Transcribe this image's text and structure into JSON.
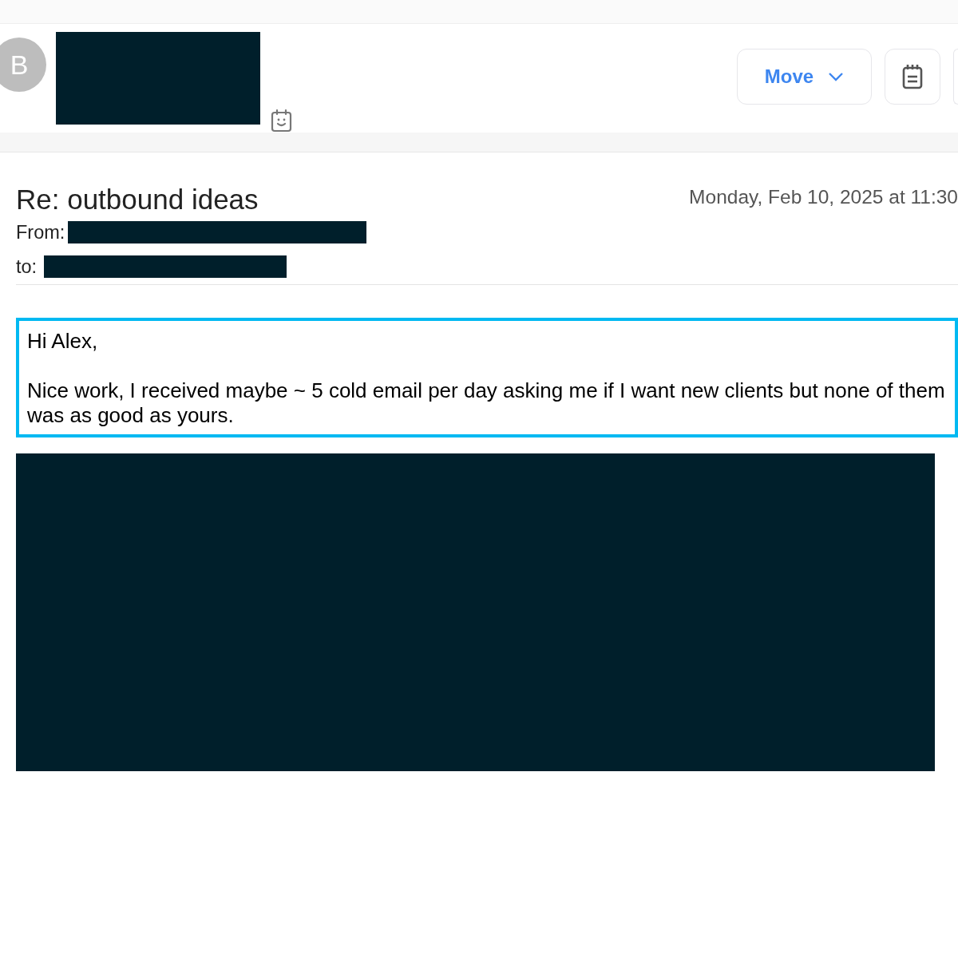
{
  "sender": {
    "avatar_letter": "B"
  },
  "toolbar": {
    "move_button": "Move"
  },
  "message": {
    "subject": "Re: outbound ideas",
    "date": "Monday, Feb 10, 2025 at 11:30",
    "from_label": "From:",
    "to_label": "to:",
    "body": [
      "Hi Alex,",
      "Nice work, I received maybe ~ 5 cold email per day asking me if I want new clients but none of them was as good as yours."
    ]
  }
}
